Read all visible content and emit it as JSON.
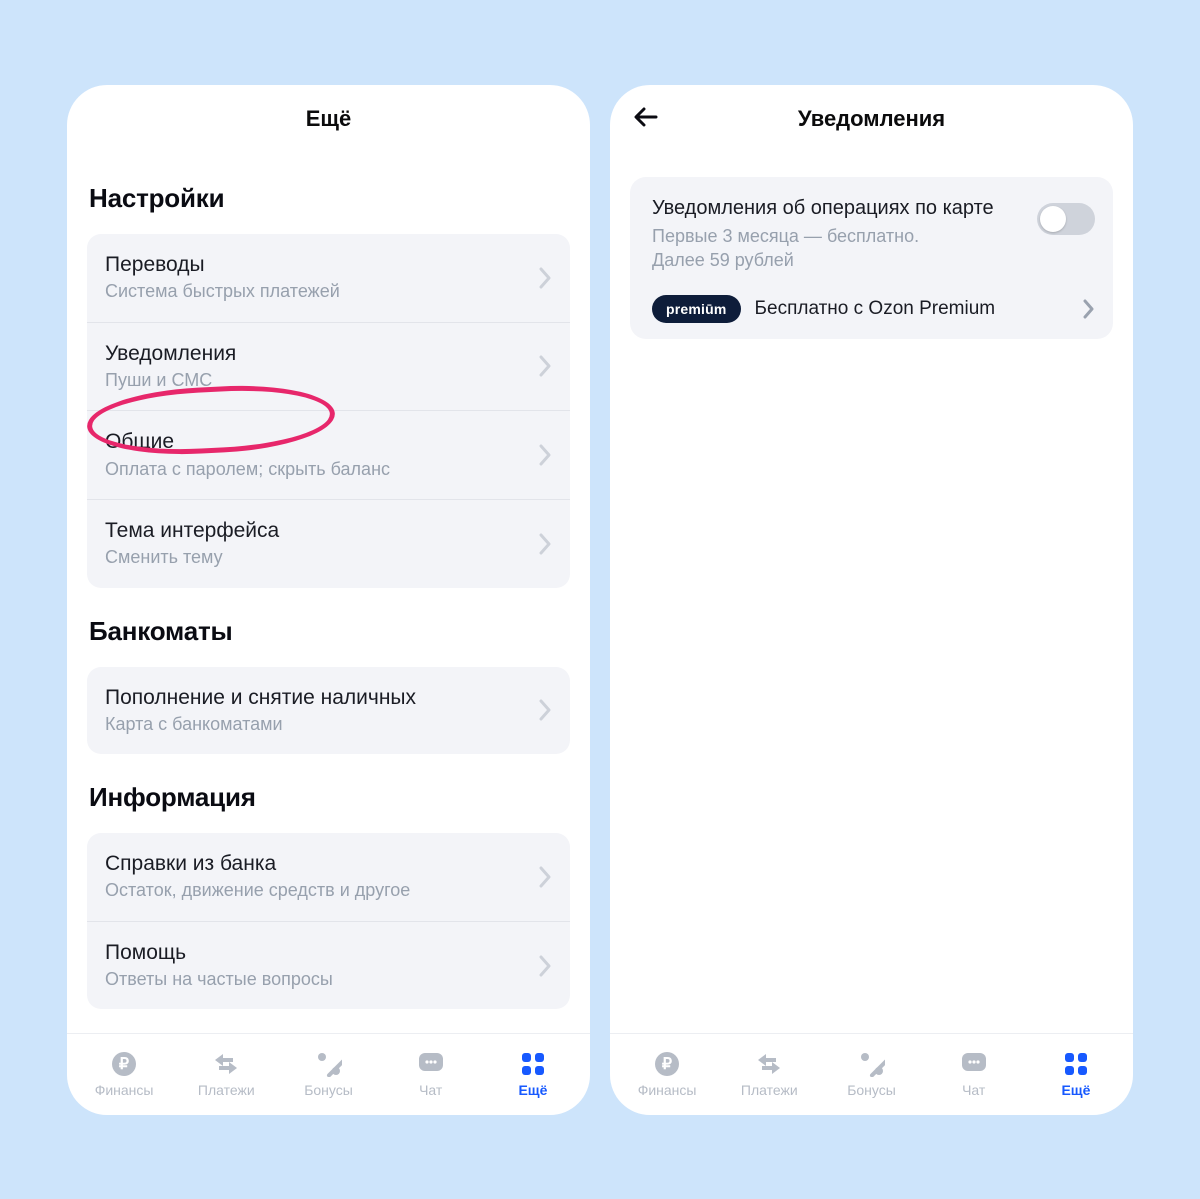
{
  "colors": {
    "accent": "#1759ff",
    "annotation": "#e7276b"
  },
  "left": {
    "header": {
      "title": "Ещё"
    },
    "sections": [
      {
        "title": "Настройки",
        "rows": [
          {
            "title": "Переводы",
            "sub": "Система быстрых платежей"
          },
          {
            "title": "Уведомления",
            "sub": "Пуши и СМС"
          },
          {
            "title": "Общие",
            "sub": "Оплата с паролем; скрыть баланс"
          },
          {
            "title": "Тема интерфейса",
            "sub": "Сменить тему"
          }
        ]
      },
      {
        "title": "Банкоматы",
        "rows": [
          {
            "title": "Пополнение и снятие наличных",
            "sub": "Карта с банкоматами"
          }
        ]
      },
      {
        "title": "Информация",
        "rows": [
          {
            "title": "Справки из банка",
            "sub": "Остаток, движение средств и другое"
          },
          {
            "title": "Помощь",
            "sub": "Ответы на частые вопросы"
          }
        ]
      }
    ]
  },
  "right": {
    "header": {
      "title": "Уведомления"
    },
    "notif": {
      "title": "Уведомления об операциях по карте",
      "sub1": "Первые 3 месяца — бесплатно.",
      "sub2": "Далее 59 рублей",
      "enabled": false
    },
    "premium": {
      "badge": "premiūm",
      "text": "Бесплатно с Ozon Premium"
    }
  },
  "tabs": [
    {
      "label": "Финансы",
      "icon": "ruble-icon",
      "active": false
    },
    {
      "label": "Платежи",
      "icon": "swap-icon",
      "active": false
    },
    {
      "label": "Бонусы",
      "icon": "percent-icon",
      "active": false
    },
    {
      "label": "Чат",
      "icon": "chat-icon",
      "active": false
    },
    {
      "label": "Ещё",
      "icon": "grid-icon",
      "active": true
    }
  ]
}
